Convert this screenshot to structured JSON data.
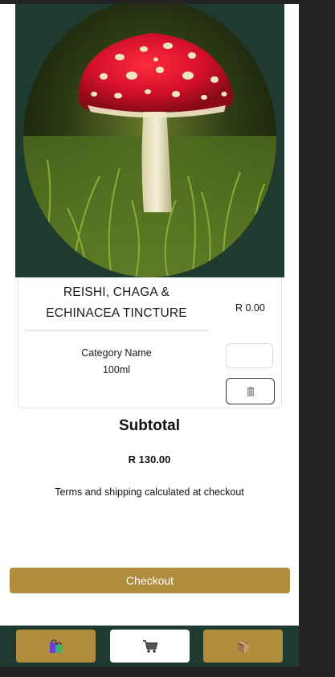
{
  "product": {
    "name": "REISHI, CHAGA & ECHINACEA TINCTURE",
    "price": "R 0.00",
    "category": "Category Name",
    "size": "100ml",
    "quantity": ""
  },
  "summary": {
    "title": "Subtotal",
    "amount": "R 130.00",
    "terms": "Terms and shipping calculated at checkout"
  },
  "checkout": {
    "label": "Checkout"
  },
  "nav": {
    "items": [
      {
        "icon": "shopping-bags-icon",
        "active": false
      },
      {
        "icon": "cart-icon",
        "active": true
      },
      {
        "icon": "package-icon",
        "active": false
      }
    ]
  },
  "colors": {
    "accent": "#b08d3c",
    "dark_green": "#1f3a2e",
    "background": "#232323"
  }
}
